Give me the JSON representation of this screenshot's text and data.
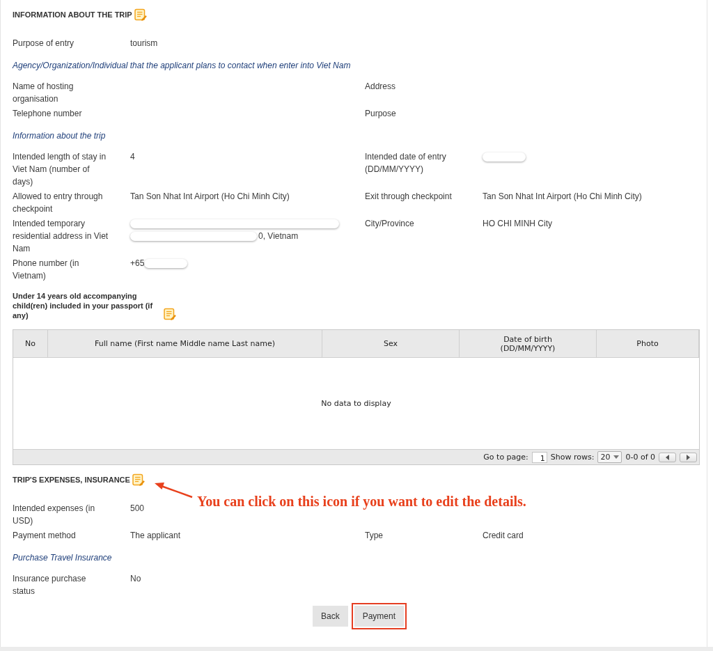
{
  "sections": [
    {
      "title": "INFORMATION ABOUT THE TRIP",
      "editable": true,
      "blocks": [
        {
          "kind": "fields",
          "rows": [
            {
              "pairs": [
                {
                  "label": "Purpose of entry",
                  "value": "tourism"
                }
              ]
            }
          ]
        },
        {
          "kind": "subheading",
          "text": "Agency/Organization/Individual that the applicant plans to contact when enter into Viet Nam"
        },
        {
          "kind": "fields",
          "rows": [
            {
              "pairs": [
                {
                  "label": "Name of hosting organisation"
                },
                {
                  "label": "Address"
                }
              ]
            },
            {
              "pairs": [
                {
                  "label": "Telephone number"
                },
                {
                  "label": "Purpose"
                }
              ]
            }
          ]
        },
        {
          "kind": "subheading",
          "text": "Information about the trip"
        },
        {
          "kind": "fields",
          "rows": [
            {
              "pairs": [
                {
                  "label": "Intended length of stay in Viet Nam (number of days)",
                  "value": "4"
                },
                {
                  "label": "Intended date of entry (DD/MM/YYYY)",
                  "parts": [
                    {
                      "kind": "redaction"
                    }
                  ]
                }
              ]
            },
            {
              "pairs": [
                {
                  "label": "Allowed to entry through checkpoint",
                  "value": "Tan Son Nhat Int Airport (Ho Chi Minh City)"
                },
                {
                  "label": "Exit through checkpoint",
                  "value": "Tan Son Nhat Int Airport (Ho Chi Minh City)"
                }
              ]
            },
            {
              "pairs": [
                {
                  "label": "Intended temporary residential address in Viet Nam",
                  "parts": [
                    {
                      "kind": "redaction"
                    },
                    {
                      "kind": "redaction"
                    },
                    {
                      "kind": "text",
                      "text": "0, Vietnam"
                    }
                  ]
                },
                {
                  "label": "City/Province",
                  "value": "HO CHI MINH City"
                }
              ]
            },
            {
              "pairs": [
                {
                  "label": "Phone number (in Vietnam)",
                  "parts": [
                    {
                      "kind": "text",
                      "text": "+65"
                    },
                    {
                      "kind": "redaction"
                    }
                  ]
                }
              ]
            }
          ]
        },
        {
          "kind": "table",
          "title": "Under 14 years old accompanying child(ren) included in your passport (if any)",
          "editable": true,
          "columns": [
            "No",
            "Full name (First name Middle name Last name)",
            "Sex",
            "Date of birth (DD/MM/YYYY)",
            "Photo"
          ],
          "empty_message": "No data to display",
          "pager": {
            "page_label": "Go to page:",
            "page": "1",
            "rows_label": "Show rows:",
            "rows": "20",
            "range": "0-0 of 0"
          }
        }
      ]
    },
    {
      "title": "TRIP'S EXPENSES, INSURANCE",
      "editable": true,
      "annotation": {
        "text": "You can click on this icon if you want to edit the details."
      },
      "blocks": [
        {
          "kind": "fields",
          "rows": [
            {
              "pairs": [
                {
                  "label": "Intended expenses (in USD)",
                  "value": "500"
                }
              ]
            },
            {
              "pairs": [
                {
                  "label": "Payment method",
                  "value": "The applicant"
                },
                {
                  "label": "Type",
                  "value": "Credit card"
                }
              ]
            }
          ]
        },
        {
          "kind": "subheading",
          "text": "Purchase Travel Insurance"
        },
        {
          "kind": "fields",
          "rows": [
            {
              "pairs": [
                {
                  "label": "Insurance purchase status",
                  "value": "No"
                }
              ]
            }
          ]
        }
      ]
    }
  ],
  "buttons": [
    {
      "label": "Back",
      "highlighted": false
    },
    {
      "label": "Payment",
      "highlighted": true
    }
  ]
}
